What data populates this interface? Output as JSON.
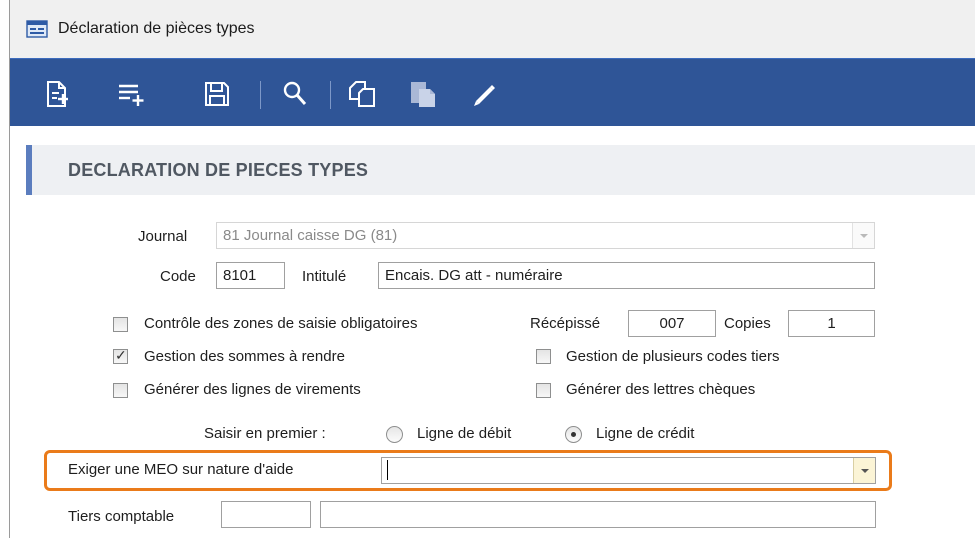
{
  "window": {
    "title": "Déclaration de pièces types"
  },
  "toolbar": {
    "buttons": [
      {
        "name": "new-document-icon"
      },
      {
        "name": "add-line-icon"
      },
      {
        "name": "save-icon"
      },
      {
        "name": "search-icon"
      },
      {
        "name": "duplicate-icon"
      },
      {
        "name": "paste-icon"
      },
      {
        "name": "edit-pencil-icon"
      }
    ],
    "colors": {
      "background": "#2f5597",
      "icon": "#ffffff",
      "disabled_icon": "#aab8d6"
    }
  },
  "header": {
    "title": "DECLARATION DE PIECES TYPES"
  },
  "form": {
    "journal": {
      "label": "Journal",
      "value": "81 Journal caisse DG (81)"
    },
    "code": {
      "label": "Code",
      "value": "8101"
    },
    "intitule": {
      "label": "Intitulé",
      "value": "Encais. DG att - numéraire"
    },
    "recepisse": {
      "label": "Récépissé",
      "value": "007"
    },
    "copies": {
      "label": "Copies",
      "value": "1"
    },
    "checkboxes": {
      "controle_zones": {
        "label": "Contrôle des zones de saisie obligatoires",
        "checked": false
      },
      "gestion_sommes": {
        "label": "Gestion des sommes à rendre",
        "checked": true
      },
      "generer_virements": {
        "label": "Générer des lignes de virements",
        "checked": false
      },
      "plusieurs_codes_tiers": {
        "label": "Gestion de plusieurs codes tiers",
        "checked": false
      },
      "lettres_cheques": {
        "label": "Générer des lettres chèques",
        "checked": false
      }
    },
    "saisir_en_premier": {
      "label": "Saisir en premier :",
      "options": [
        {
          "label": "Ligne de débit",
          "selected": false
        },
        {
          "label": "Ligne de crédit",
          "selected": true
        }
      ]
    },
    "exiger_meo": {
      "label": "Exiger une MEO sur nature d'aide",
      "value": ""
    },
    "tiers_comptable": {
      "label": "Tiers comptable",
      "code": "",
      "name": ""
    }
  },
  "highlight_color": "#ea7b1a"
}
